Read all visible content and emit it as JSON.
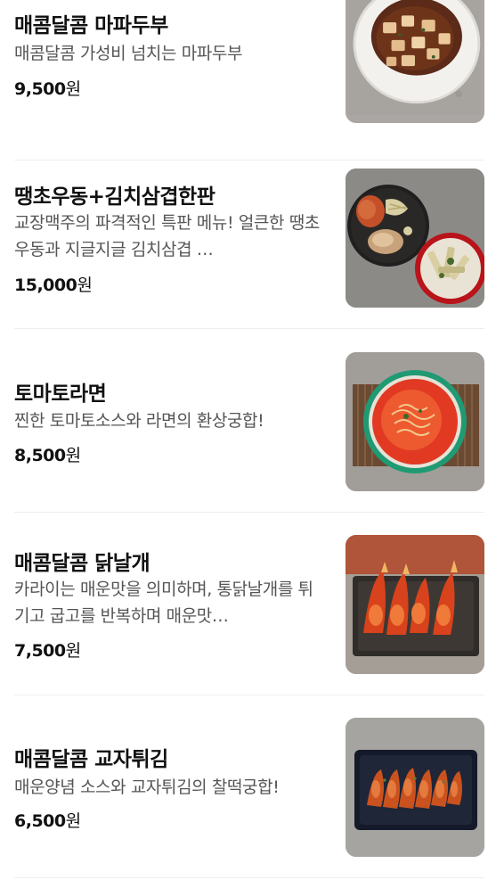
{
  "menu": {
    "currency_suffix": "원",
    "items": [
      {
        "name": "매콤달콤 마파두부",
        "description": "매콤달콤 가성비 넘치는 마파두부",
        "price": "9,500",
        "image_icon": "mapo-tofu-photo"
      },
      {
        "name": "땡초우동+김치삼겹한판",
        "description": "교장맥주의 파격적인 특판 메뉴! 얼큰한 땡초우동과 지글지글 김치삼겹 …",
        "price": "15,000",
        "image_icon": "udon-kimchi-pork-photo"
      },
      {
        "name": "토마토라면",
        "description": "찐한 토마토소스와 라면의 환상궁합!",
        "price": "8,500",
        "image_icon": "tomato-ramen-photo"
      },
      {
        "name": "매콤달콤 닭날개",
        "description": "카라이는 매운맛을 의미하며, 통닭날개를 튀기고 굽고를 반복하며 매운맛…",
        "price": "7,500",
        "image_icon": "chicken-wings-photo"
      },
      {
        "name": "매콤달콤 교자튀김",
        "description": "매운양념 소스와 교자튀김의 찰떡궁합!",
        "price": "6,500",
        "image_icon": "fried-gyoza-photo"
      }
    ]
  }
}
